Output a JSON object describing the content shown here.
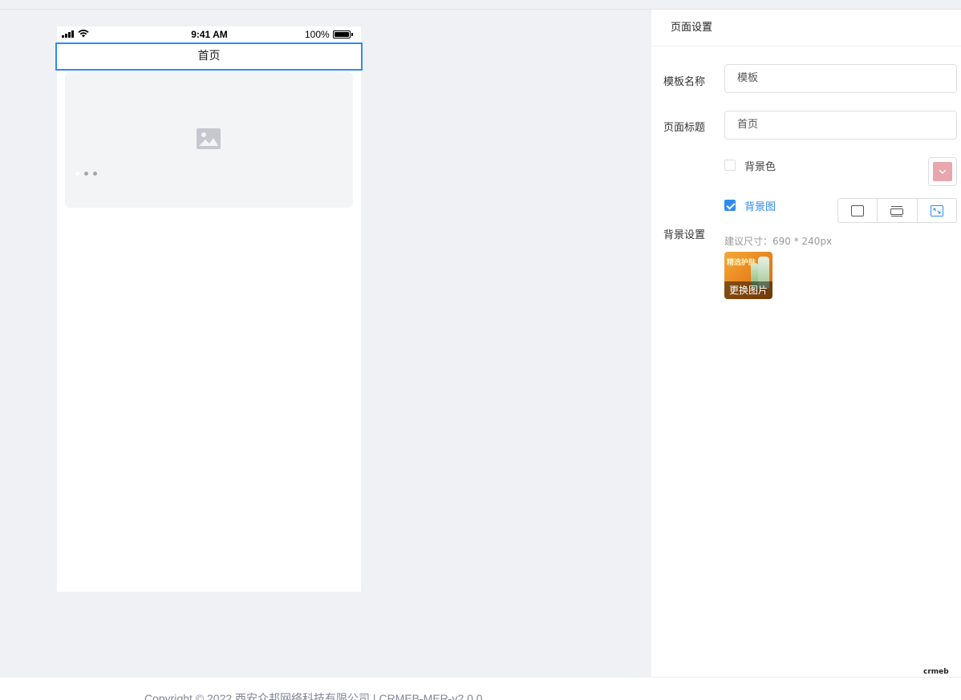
{
  "preview": {
    "status_bar": {
      "time": "9:41 AM",
      "battery_percent": "100%"
    },
    "nav_title": "首页",
    "banner": {
      "dot_count": 3,
      "active_dot": 0
    }
  },
  "panel": {
    "header": "页面设置",
    "template_name": {
      "label": "模板名称",
      "value": "模板"
    },
    "page_title": {
      "label": "页面标题",
      "value": "首页"
    },
    "background": {
      "label": "背景设置",
      "bg_color": {
        "label": "背景色",
        "checked": false,
        "color": "#e8a6ae"
      },
      "bg_image": {
        "label": "背景图",
        "checked": true
      },
      "size_hint": "建议尺寸：690 * 240px",
      "change_image": "更换图片",
      "fill_modes": [
        "contain-icon",
        "repeat-icon",
        "cover-icon"
      ],
      "active_fill_mode": 2
    }
  },
  "logo": "crmeb",
  "footer": {
    "copyright": "Copyright © 2022 西安众邦网络科技有限公司 | CRMEB-MER-v2.0.0"
  },
  "colors": {
    "accent": "#2d8cf0",
    "page_bg": "#f0f1f5"
  }
}
